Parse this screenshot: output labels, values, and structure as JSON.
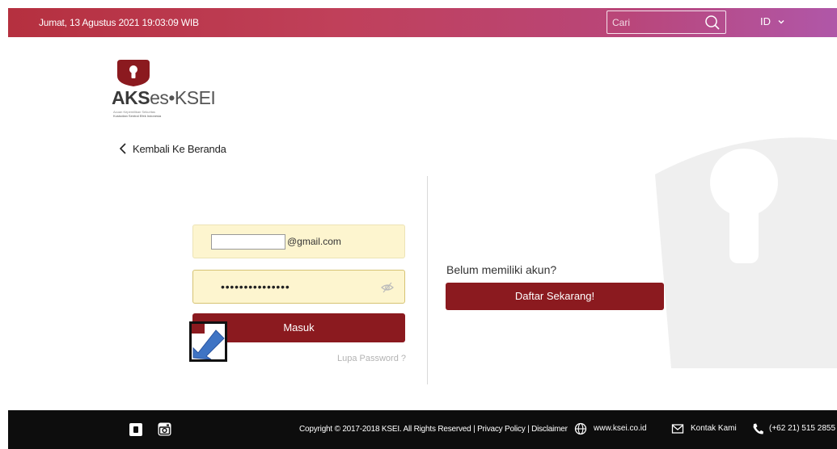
{
  "topbar": {
    "datetime": "Jumat, 13 Agustus 2021 19:03:09 WIB",
    "search_placeholder": "Cari",
    "language": "ID"
  },
  "logo": {
    "wordmark_a": "AKS",
    "wordmark_b": "es",
    "wordmark_c": "•KSEI",
    "tagline_1": "Acuan Kepemilikan Sekuritas",
    "tagline_2": "Kustodian Sentral Efek Indonesia"
  },
  "nav": {
    "back_label": "Kembali Ke Beranda"
  },
  "login": {
    "email_suffix": "@gmail.com",
    "password_mask": "•••••••••••••••",
    "submit_label": "Masuk",
    "forgot_label": "Lupa Password ?"
  },
  "register": {
    "prompt": "Belum memiliki akun?",
    "button_label": "Daftar Sekarang!"
  },
  "footer": {
    "copyright": "Copyright © 2017-2018 KSEI. All Rights Reserved | Privacy Policy | Disclaimer",
    "website": "www.ksei.co.id",
    "contact": "Kontak Kami",
    "phone": "(+62 21) 515 2855"
  },
  "colors": {
    "primary_red": "#8b1a1f",
    "topbar_start": "#b5303f",
    "topbar_end": "#b057a8",
    "input_bg": "#fdf5cf",
    "cursor_blue": "#3f74c4"
  },
  "icons": {
    "search": "search-icon",
    "language_dropdown": "chevron-down-icon",
    "back": "chevron-left-icon",
    "password_visibility": "eye-slash-icon",
    "cursor": "pointer-arrow-icon",
    "youtube": "youtube-icon",
    "instagram": "instagram-icon",
    "website": "globe-icon",
    "contact": "mail-icon",
    "phone": "phone-icon"
  }
}
